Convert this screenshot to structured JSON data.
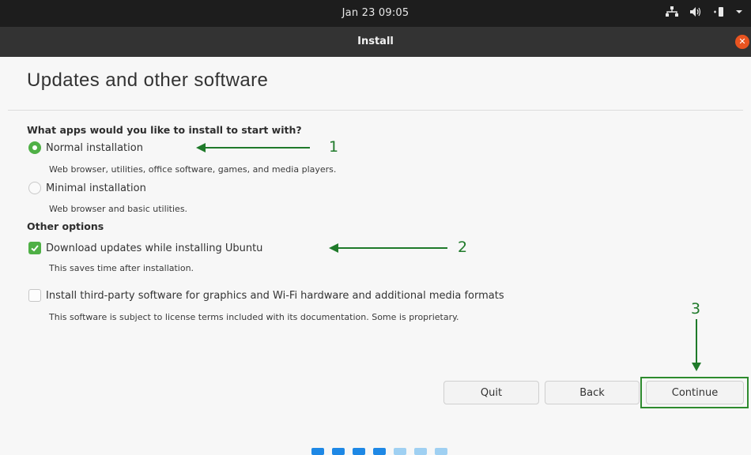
{
  "topbar": {
    "clock": "Jan 23  09:05"
  },
  "window": {
    "title": "Install"
  },
  "page": {
    "heading": "Updates and other software"
  },
  "apps_section": {
    "label": "What apps would you like to install to start with?",
    "options": [
      {
        "label": "Normal installation",
        "description": "Web browser, utilities, office software, games, and media players.",
        "selected": true
      },
      {
        "label": "Minimal installation",
        "description": "Web browser and basic utilities.",
        "selected": false
      }
    ]
  },
  "other_section": {
    "label": "Other options",
    "options": [
      {
        "label": "Download updates while installing Ubuntu",
        "description": "This saves time after installation.",
        "checked": true
      },
      {
        "label": "Install third-party software for graphics and Wi-Fi hardware and additional media formats",
        "description": "This software is subject to license terms included with its documentation. Some is proprietary.",
        "checked": false
      }
    ]
  },
  "buttons": {
    "quit": "Quit",
    "back": "Back",
    "continue": "Continue"
  },
  "annotations": [
    "1",
    "2",
    "3"
  ],
  "progress": {
    "total_steps": 7,
    "active_steps": 4,
    "active_color": "#1e88e5",
    "inactive_color": "#9fd0f2"
  },
  "colors": {
    "accent_green": "#4fb046",
    "annotation_green": "#1f7a2a",
    "close_orange": "#e95420"
  },
  "icons": {
    "tray": [
      "network-icon",
      "volume-icon",
      "battery-icon",
      "menu-caret-icon"
    ]
  }
}
